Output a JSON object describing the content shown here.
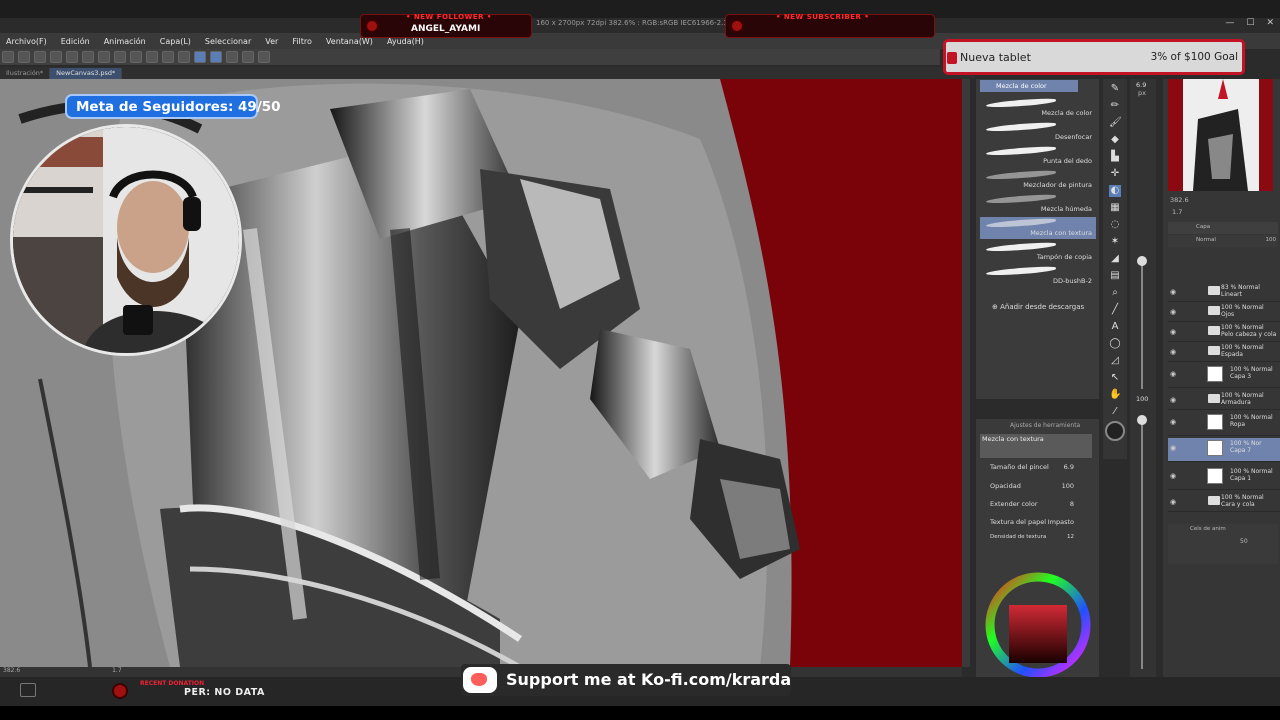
{
  "menu": [
    "Archivo(F)",
    "Edición",
    "Animación",
    "Capa(L)",
    "Seleccionar",
    "Ver",
    "Filtro",
    "Ventana(W)",
    "Ayuda(H)"
  ],
  "title_info": "160 x 2700px 72dpi 382.6% : RGB:sRGB IEC61966-2.1)",
  "tabs": [
    "Ilustración*",
    "NewCanvas3.psd*"
  ],
  "alerts": {
    "follower_header": "• NEW FOLLOWER •",
    "follower_name": "ANGEL_AYAMI",
    "subscriber_header": "• NEW SUBSCRIBER •"
  },
  "goal_badge": "Meta de Seguidores:  49/50",
  "tablet_goal": {
    "name": "Nueva tablet",
    "amount": "3% of $100 Goal"
  },
  "brush_panel": {
    "header": "Mezcla de color",
    "items": [
      "Mezcla de color",
      "Desenfocar",
      "Punta del dedo",
      "Mezclador de pintura",
      "Mezcla húmeda",
      "Mezcla con textura",
      "Tampón de copia",
      "DD-bushB-2"
    ],
    "add_label": "Añadir desde descargas"
  },
  "tool_props": {
    "title": "Ajustes de herramienta",
    "name": "Mezcla con textura",
    "rows": [
      {
        "label": "Tamaño del pincel",
        "value": "6.9"
      },
      {
        "label": "Opacidad",
        "value": "100"
      },
      {
        "label": "Extender color",
        "value": "8"
      },
      {
        "label": "Textura del papel",
        "value": "Impasto"
      },
      {
        "label": "Densidad de textura",
        "value": "12"
      }
    ]
  },
  "size_values": {
    "brush": "6.9",
    "brush_unit": "px",
    "opacity": "100"
  },
  "navigator": {
    "zoom": "382.6",
    "angle": "1.7"
  },
  "canvas_status": {
    "zoom": "382.6",
    "angle": "1.7"
  },
  "layers": [
    {
      "pct": "83 % Normal",
      "name": "Lineart",
      "type": "folder"
    },
    {
      "pct": "100 % Normal",
      "name": "Ojos",
      "type": "folder"
    },
    {
      "pct": "100 % Normal",
      "name": "Pelo cabeza y cola",
      "type": "folder"
    },
    {
      "pct": "100 % Normal",
      "name": "Espada",
      "type": "folder"
    },
    {
      "pct": "100 % Normal",
      "name": "Capa 3",
      "type": "layer"
    },
    {
      "pct": "100 % Normal",
      "name": "Armadura",
      "type": "folder"
    },
    {
      "pct": "100 % Normal",
      "name": "Ropa",
      "type": "layer"
    },
    {
      "pct": "100 % Nor",
      "name": "Capa 7",
      "type": "layer",
      "selected": true
    },
    {
      "pct": "100 % Normal",
      "name": "Capa 1",
      "type": "layer"
    },
    {
      "pct": "100 % Normal",
      "name": "Cara y cola",
      "type": "folder"
    }
  ],
  "layer_header": {
    "blend": "Normal",
    "opacity": "100"
  },
  "cels": {
    "title": "Cels de anim",
    "value": "50"
  },
  "recent": {
    "label": "RECENT DONATION",
    "data": "PER: NO DATA"
  },
  "kofi": "Support me at Ko-fi.com/krarda",
  "colors": {
    "canvas_bg": "#7a0309",
    "accent": "#6f83ad",
    "goal_blue": "#1f6fe0",
    "alert_red": "#ff2b2b"
  }
}
